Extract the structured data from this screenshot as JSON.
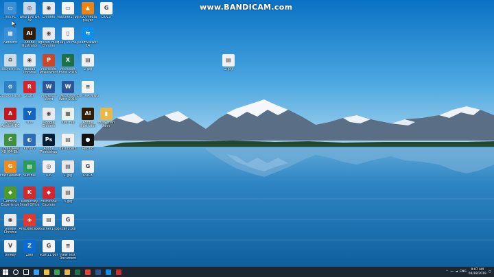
{
  "watermark": "www.BANDICAM.com",
  "colors": {
    "sky_top": "#0d7ed0",
    "sky_bottom": "#8ec8ea",
    "lake": "#1b6fae",
    "taskbar": "#1b2631"
  },
  "desktop_icons": [
    {
      "label": "This PC",
      "icon": "this-pc-icon",
      "color": "#3a8fd6",
      "glyph": "▭"
    },
    {
      "label": "Network",
      "icon": "network-icon",
      "color": "#3a8fd6",
      "glyph": "▦"
    },
    {
      "label": "Recycle Bin",
      "icon": "recycle-bin-icon",
      "color": "#cfdbe6",
      "glyph": "♻"
    },
    {
      "label": "Control Panel",
      "icon": "control-panel-icon",
      "color": "#2f7fc1",
      "glyph": "⚙"
    },
    {
      "label": "Adobe Acrobat DC",
      "icon": "acrobat-icon",
      "color": "#c4161c",
      "glyph": "A"
    },
    {
      "label": "CorelDRAW X8 (64-Bit)",
      "icon": "coreldraw-icon",
      "color": "#3f8f3f",
      "glyph": "C"
    },
    {
      "label": "Foxit Reader",
      "icon": "foxit-reader-icon",
      "color": "#f08a1d",
      "glyph": "G"
    },
    {
      "label": "GeForce Experience",
      "icon": "geforce-icon",
      "color": "#4c9a2a",
      "glyph": "◆"
    },
    {
      "label": "Google Chrome",
      "icon": "chrome-icon",
      "color": "#e8eaed",
      "glyph": "◉"
    },
    {
      "label": "UniKey",
      "icon": "unikey-icon",
      "color": "#f2f2f2",
      "glyph": "V"
    },
    {
      "label": "Web Eye On 3x",
      "icon": "webcam-icon",
      "color": "#c8d7ea",
      "glyph": "◎"
    },
    {
      "label": "Adobe Illustrator",
      "icon": "illustrator-icon",
      "color": "#331c00",
      "glyph": "Ai"
    },
    {
      "label": "taobao Chrome",
      "icon": "chrome-icon",
      "color": "#e8eaed",
      "glyph": "◉"
    },
    {
      "label": "Zuzu",
      "icon": "zuzu-icon",
      "color": "#d8232a",
      "glyph": "R"
    },
    {
      "label": "Ylilo",
      "icon": "ylilo-icon",
      "color": "#1565c0",
      "glyph": "Y"
    },
    {
      "label": "KBVMS",
      "icon": "kbvms-icon",
      "color": "#2d6cb5",
      "glyph": "◐"
    },
    {
      "label": "Sub file",
      "icon": "green-app-icon",
      "color": "#2c9a5a",
      "glyph": "▤"
    },
    {
      "label": "Kaspersky Small Office",
      "icon": "kaspersky-icon",
      "color": "#d12a2a",
      "glyph": "K"
    },
    {
      "label": "AnyDesk.exe",
      "icon": "anydesk-icon",
      "color": "#e03a2e",
      "glyph": "◈"
    },
    {
      "label": "Zalo",
      "icon": "zalo-icon",
      "color": "#0b6ad6",
      "glyph": "Z"
    },
    {
      "label": "Nguyen Hue - Chrome",
      "icon": "chrome-icon",
      "color": "#e8eaed",
      "glyph": "◉"
    },
    {
      "label": "Microsoft PowerPoint",
      "icon": "powerpoint-icon",
      "color": "#d04525",
      "glyph": "P"
    },
    {
      "label": "Microsoft Word",
      "icon": "word-icon",
      "color": "#2b579a",
      "glyph": "W"
    },
    {
      "label": "Google Chrome",
      "icon": "chrome-icon",
      "color": "#e8eaed",
      "glyph": "◉"
    },
    {
      "label": "Chrome",
      "icon": "chrome-icon",
      "color": "#e8eaed",
      "glyph": "◉"
    },
    {
      "label": "Adobe Photoshop",
      "icon": "photoshop-icon",
      "color": "#001e36",
      "glyph": "Ps"
    },
    {
      "label": "IC6",
      "icon": "webcam2-icon",
      "color": "#f0f0f0",
      "glyph": "◎"
    },
    {
      "label": "FastStone Capture",
      "icon": "faststone-icon",
      "color": "#d4252f",
      "glyph": "◆"
    },
    {
      "label": "voucher1.jpg",
      "icon": "image-file-icon",
      "color": "#f4f4f4",
      "glyph": "▤"
    },
    {
      "label": "voucher2.jpg",
      "icon": "image-file-icon",
      "color": "#f4f4f4",
      "glyph": "▭"
    },
    {
      "label": "quay ve may",
      "icon": "file-icon",
      "color": "#f5f5f5",
      "glyph": "▯"
    },
    {
      "label": "Microsoft Excel 2016",
      "icon": "excel-icon",
      "color": "#1e7145",
      "glyph": "X"
    },
    {
      "label": "Microsoft Word 2016",
      "icon": "word-icon",
      "color": "#2b579a",
      "glyph": "W"
    },
    {
      "label": "XML file",
      "icon": "spreadsheet-icon",
      "color": "#e9f2e9",
      "glyph": "▦"
    },
    {
      "label": "dashboard",
      "icon": "image-file-icon",
      "color": "#f2f2f2",
      "glyph": "▤"
    },
    {
      "label": "1.jpg",
      "icon": "jpg-file-icon",
      "color": "#e8e8e8",
      "glyph": "▤"
    },
    {
      "label": "3.jpg",
      "icon": "jpg-file-icon",
      "color": "#e8e8e8",
      "glyph": "▤"
    },
    {
      "label": "scan1.pdf",
      "icon": "pdf-file-icon",
      "color": "#f4f4f4",
      "glyph": "G"
    },
    {
      "label": "scan11.pdf",
      "icon": "pdf-file-icon",
      "color": "#f4f4f4",
      "glyph": "G"
    },
    {
      "label": "VLC media player",
      "icon": "vlc-icon",
      "color": "#f3820b",
      "glyph": "▲"
    },
    {
      "label": "TeamViewer 14",
      "icon": "teamviewer-icon",
      "color": "#0e8ee9",
      "glyph": "⇆"
    },
    {
      "label": "2.jpg",
      "icon": "image-file-icon",
      "color": "#f0f0f0",
      "glyph": "▤"
    },
    {
      "label": "Edi TRAINING",
      "icon": "text-file-icon",
      "color": "#f4f4f4",
      "glyph": "≡"
    },
    {
      "label": "Adobe Illustrator",
      "icon": "illustrator-icon",
      "color": "#331c00",
      "glyph": "Ai"
    },
    {
      "label": "Record",
      "icon": "record-icon",
      "color": "#111111",
      "glyph": "●"
    },
    {
      "label": "DOCX",
      "icon": "docx-file-icon",
      "color": "#f4f4f4",
      "glyph": "G"
    },
    {
      "label": "DOCX",
      "icon": "docx-file-icon",
      "color": "#f4f4f4",
      "glyph": "G"
    },
    {
      "label": "quay man hinh",
      "icon": "folder-icon",
      "color": "#e8b84a",
      "glyph": "▮"
    },
    {
      "label": "2.jpg",
      "icon": "image-file-icon",
      "color": "#f0f0f0",
      "glyph": "▤"
    },
    {
      "label": "New Text Document",
      "icon": "text-document-icon",
      "color": "#f4f4f4",
      "glyph": "≡"
    }
  ],
  "taskbar": {
    "apps": [
      {
        "name": "search-icon",
        "color": "#ffffff"
      },
      {
        "name": "task-view-icon",
        "color": "#ffffff"
      },
      {
        "name": "photoshop-task-icon",
        "color": "#2da3ff"
      },
      {
        "name": "file-explorer-task-icon",
        "color": "#f0c040"
      },
      {
        "name": "chrome-task-icon",
        "color": "#34a853"
      },
      {
        "name": "folder-task-icon",
        "color": "#e8b84a"
      },
      {
        "name": "excel-task-icon",
        "color": "#1e7145"
      },
      {
        "name": "chrome2-task-icon",
        "color": "#ea4335"
      },
      {
        "name": "word-task-icon",
        "color": "#2b579a"
      },
      {
        "name": "teamviewer-task-icon",
        "color": "#0e8ee9"
      },
      {
        "name": "bandicam-task-icon",
        "color": "#d12a2a"
      }
    ],
    "tray": {
      "lang": "ENG",
      "time": "9:07 AM",
      "date": "04/18/2019"
    }
  }
}
